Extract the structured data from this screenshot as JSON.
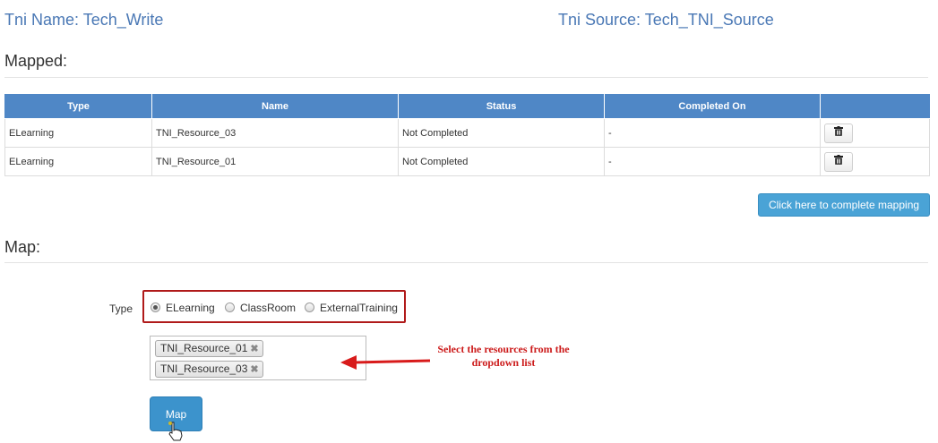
{
  "header": {
    "tni_name": "Tni Name: Tech_Write",
    "tni_source": "Tni Source: Tech_TNI_Source"
  },
  "mapped": {
    "title": "Mapped:",
    "columns": [
      "Type",
      "Name",
      "Status",
      "Completed On",
      ""
    ],
    "rows": [
      {
        "type": "ELearning",
        "name": "TNI_Resource_03",
        "status": "Not Completed",
        "completed_on": "-"
      },
      {
        "type": "ELearning",
        "name": "TNI_Resource_01",
        "status": "Not Completed",
        "completed_on": "-"
      }
    ],
    "complete_button": "Click here to complete mapping"
  },
  "map": {
    "title": "Map:",
    "type_label": "Type",
    "type_options": [
      {
        "label": "ELearning",
        "selected": true
      },
      {
        "label": "ClassRoom",
        "selected": false
      },
      {
        "label": "ExternalTraining",
        "selected": false
      }
    ],
    "selected_resources": [
      "TNI_Resource_01",
      "TNI_Resource_03"
    ],
    "chip_remove_glyph": "✖",
    "annotation": "Select the resources from the dropdown list",
    "map_button": "Map"
  },
  "icons": {
    "delete": "trash-icon",
    "cursor": "hand-pointer-icon"
  },
  "colors": {
    "header_link": "#4a78b5",
    "table_header": "#4f87c6",
    "button_blue": "#4aa3d6",
    "annotation_red": "#cc1b1b"
  }
}
